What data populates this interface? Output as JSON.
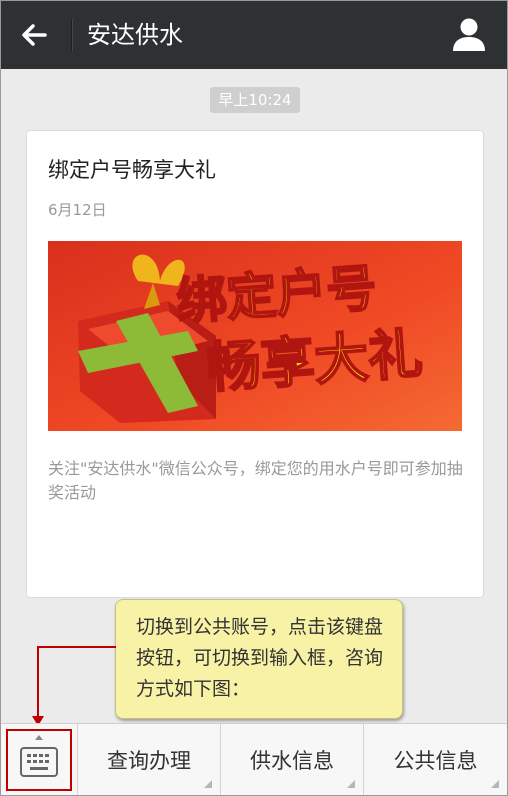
{
  "header": {
    "title": "安达供水",
    "back_icon": "back-arrow-icon",
    "profile_icon": "person-icon"
  },
  "chat": {
    "time": "早上10:24"
  },
  "article": {
    "title": "绑定户号畅享大礼",
    "date": "6月12日",
    "banner_line1": "绑定户号",
    "banner_line2": "畅享大礼",
    "description": "关注\"安达供水\"微信公众号，绑定您的用水户号即可参加抽奖活动"
  },
  "tooltip": {
    "text": "切换到公共账号，点击该键盘按钮，可切换到输入框，咨询方式如下图："
  },
  "bottom_menu": {
    "keyboard_icon": "keyboard-icon",
    "items": [
      {
        "label": "查询办理"
      },
      {
        "label": "供水信息"
      },
      {
        "label": "公共信息"
      }
    ]
  },
  "colors": {
    "header_bg": "#2e3133",
    "accent_red": "#c00000",
    "tooltip_bg": "#f8f2a6",
    "banner_yellow": "#ffe600"
  }
}
